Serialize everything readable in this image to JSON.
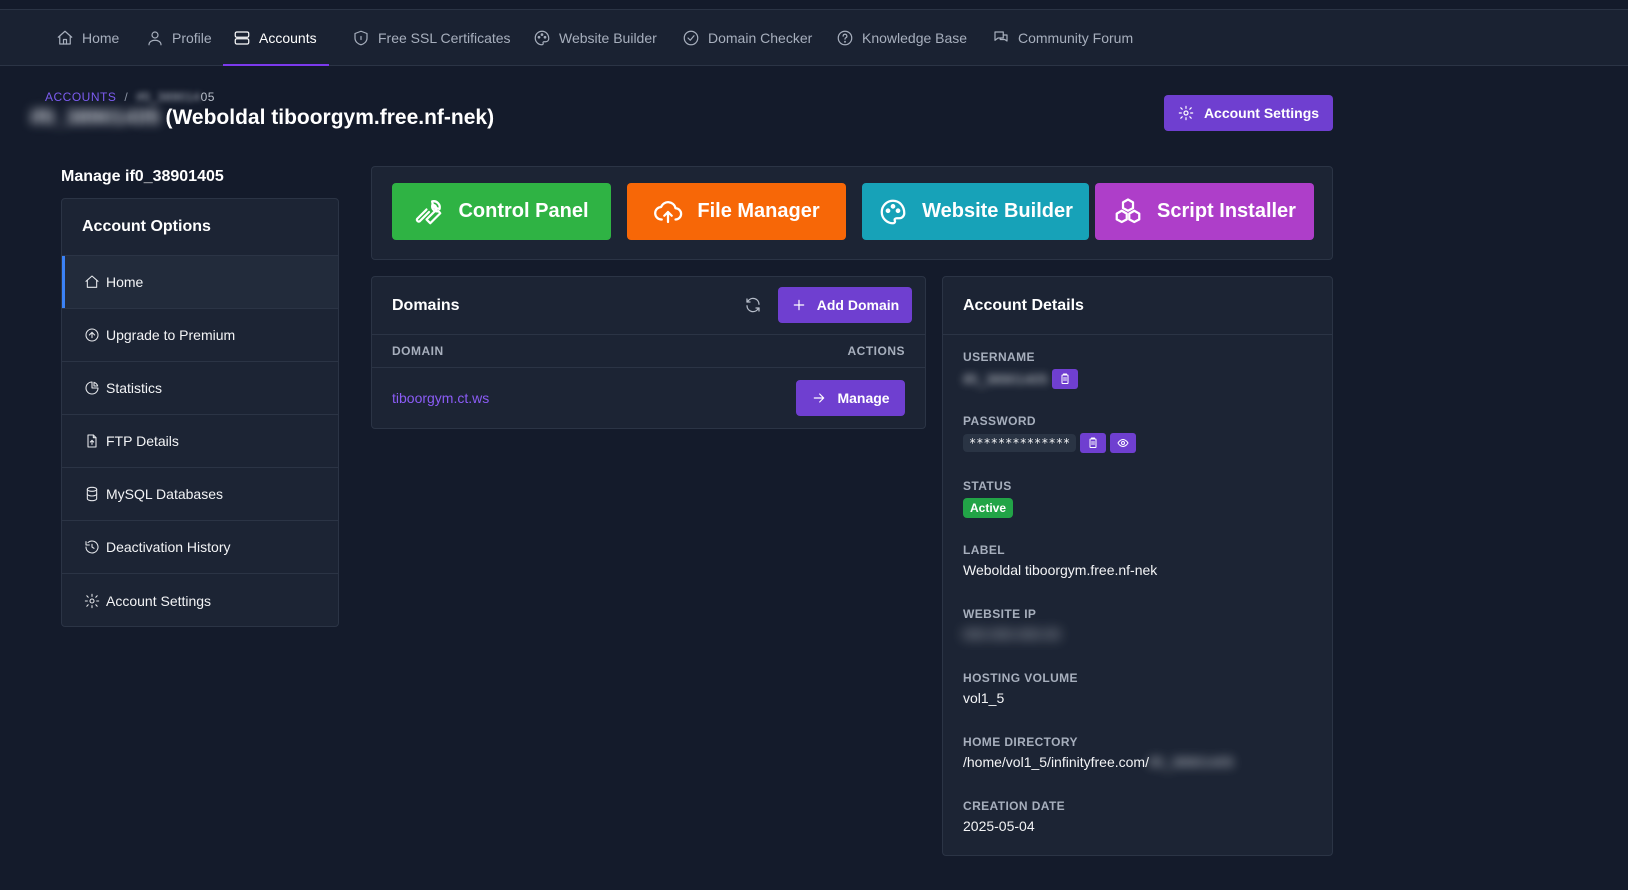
{
  "nav": {
    "items": [
      {
        "label": "Home",
        "icon": "home-icon"
      },
      {
        "label": "Profile",
        "icon": "user-icon"
      },
      {
        "label": "Accounts",
        "icon": "server-icon"
      },
      {
        "label": "Free SSL Certificates",
        "icon": "shield-icon"
      },
      {
        "label": "Website Builder",
        "icon": "palette-icon"
      },
      {
        "label": "Domain Checker",
        "icon": "check-circle-icon"
      },
      {
        "label": "Knowledge Base",
        "icon": "question-circle-icon"
      },
      {
        "label": "Community Forum",
        "icon": "chat-icon"
      }
    ],
    "active": "Accounts"
  },
  "breadcrumb": {
    "root": "ACCOUNTS",
    "separator": "/",
    "current": "05"
  },
  "page": {
    "title_blurred": "05",
    "title": " (Weboldal tiboorgym.free.nf-nek)",
    "settings_button": "Account Settings"
  },
  "sidebar": {
    "manage_heading": "Manage if0_38901405",
    "header": "Account Options",
    "items": [
      {
        "label": "Home",
        "icon": "home-icon"
      },
      {
        "label": "Upgrade to Premium",
        "icon": "arrow-up-circle-icon"
      },
      {
        "label": "Statistics",
        "icon": "pie-chart-icon"
      },
      {
        "label": "FTP Details",
        "icon": "file-upload-icon"
      },
      {
        "label": "MySQL Databases",
        "icon": "database-icon"
      },
      {
        "label": "Deactivation History",
        "icon": "history-icon"
      },
      {
        "label": "Account Settings",
        "icon": "gear-icon"
      }
    ]
  },
  "tools": {
    "control_panel": "Control Panel",
    "file_manager": "File Manager",
    "website_builder": "Website Builder",
    "script_installer": "Script Installer"
  },
  "colors": {
    "accent": "#6f3fd0",
    "control_panel": "#2fb344",
    "file_manager": "#f76707",
    "website_builder": "#17a2b8",
    "script_installer": "#ae3ec9",
    "status_active": "#22a447"
  },
  "domains": {
    "title": "Domains",
    "add_button": "Add Domain",
    "col_domain": "DOMAIN",
    "col_actions": "ACTIONS",
    "rows": [
      {
        "domain": "tiboorgym.ct.ws",
        "action": "Manage"
      }
    ]
  },
  "details": {
    "title": "Account Details",
    "username_label": "USERNAME",
    "username_value": "if0_38901405",
    "password_label": "PASSWORD",
    "password_value": "**************",
    "status_label": "STATUS",
    "status_value": "Active",
    "label_label": "LABEL",
    "label_value": "Weboldal tiboorgym.free.nf-nek",
    "ip_label": "WEBSITE IP",
    "ip_value": "000.000.000.00",
    "volume_label": "HOSTING VOLUME",
    "volume_value": "vol1_5",
    "homedir_label": "HOME DIRECTORY",
    "homedir_value": "/home/vol1_5/infinityfree.com/",
    "homedir_blurred": "if0_38901405",
    "created_label": "CREATION DATE",
    "created_value": "2025-05-04"
  }
}
